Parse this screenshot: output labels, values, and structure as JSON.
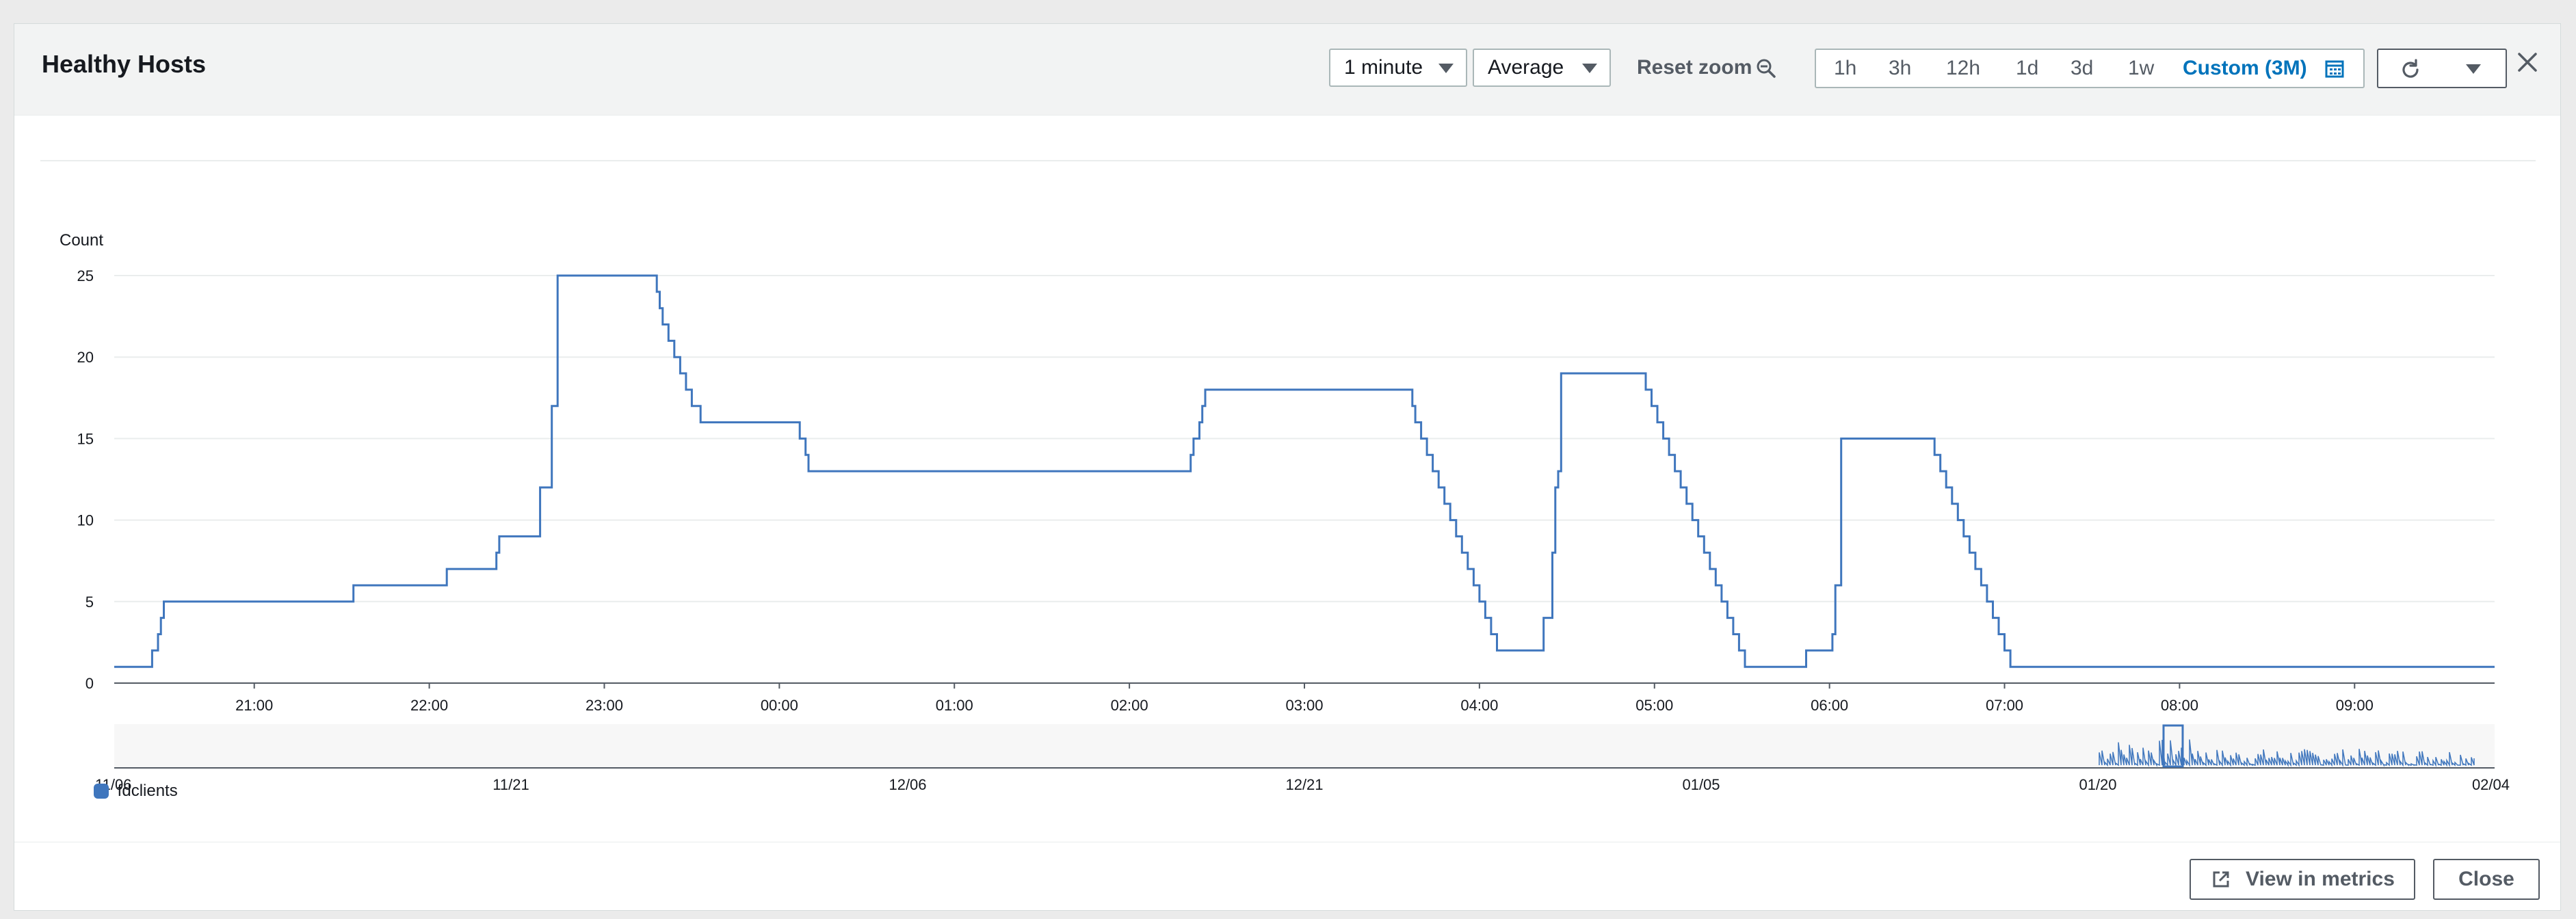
{
  "modal": {
    "title": "Healthy Hosts"
  },
  "toolbar": {
    "period": "1 minute",
    "statistic": "Average",
    "reset_zoom": "Reset zoom",
    "ranges": [
      "1h",
      "3h",
      "12h",
      "1d",
      "3d",
      "1w"
    ],
    "custom_range": "Custom (3M)",
    "icons": {
      "zoom": "zoom-out-icon",
      "calendar": "calendar-icon",
      "refresh": "refresh-icon",
      "menu": "caret-down-icon",
      "close": "close-icon"
    }
  },
  "chart_data": {
    "type": "line",
    "title": "",
    "ylabel": "Count",
    "xlabel": "",
    "ylim": [
      0,
      25
    ],
    "yticks": [
      0,
      5,
      10,
      15,
      20,
      25
    ],
    "xticks": [
      "21:00",
      "22:00",
      "23:00",
      "00:00",
      "01:00",
      "02:00",
      "03:00",
      "04:00",
      "05:00",
      "06:00",
      "07:00",
      "08:00",
      "09:00"
    ],
    "grid": true,
    "color": "#3f76bd",
    "series": [
      {
        "name": "fdclients",
        "points": [
          [
            "20:12",
            1
          ],
          [
            "20:24",
            1
          ],
          [
            "20:25",
            2
          ],
          [
            "20:26",
            2
          ],
          [
            "20:27",
            3
          ],
          [
            "20:28",
            4
          ],
          [
            "20:29",
            5
          ],
          [
            "21:33",
            5
          ],
          [
            "21:34",
            6
          ],
          [
            "22:05",
            6
          ],
          [
            "22:06",
            7
          ],
          [
            "22:22",
            7
          ],
          [
            "22:23",
            8
          ],
          [
            "22:24",
            9
          ],
          [
            "22:37",
            9
          ],
          [
            "22:38",
            12
          ],
          [
            "22:41",
            12
          ],
          [
            "22:42",
            17
          ],
          [
            "22:43",
            17
          ],
          [
            "22:44",
            25
          ],
          [
            "23:17",
            25
          ],
          [
            "23:18",
            24
          ],
          [
            "23:19",
            23
          ],
          [
            "23:20",
            22
          ],
          [
            "23:22",
            21
          ],
          [
            "23:24",
            20
          ],
          [
            "23:26",
            19
          ],
          [
            "23:28",
            18
          ],
          [
            "23:30",
            17
          ],
          [
            "23:33",
            16
          ],
          [
            "00:06",
            16
          ],
          [
            "00:07",
            15
          ],
          [
            "00:09",
            14
          ],
          [
            "00:10",
            13
          ],
          [
            "02:20",
            13
          ],
          [
            "02:21",
            14
          ],
          [
            "02:22",
            15
          ],
          [
            "02:24",
            16
          ],
          [
            "02:25",
            17
          ],
          [
            "02:26",
            18
          ],
          [
            "03:36",
            18
          ],
          [
            "03:37",
            17
          ],
          [
            "03:38",
            16
          ],
          [
            "03:40",
            15
          ],
          [
            "03:42",
            14
          ],
          [
            "03:44",
            13
          ],
          [
            "03:46",
            12
          ],
          [
            "03:48",
            11
          ],
          [
            "03:50",
            10
          ],
          [
            "03:52",
            9
          ],
          [
            "03:54",
            8
          ],
          [
            "03:56",
            7
          ],
          [
            "03:58",
            6
          ],
          [
            "04:00",
            5
          ],
          [
            "04:02",
            4
          ],
          [
            "04:04",
            3
          ],
          [
            "04:06",
            2
          ],
          [
            "04:21",
            2
          ],
          [
            "04:22",
            4
          ],
          [
            "04:24",
            4
          ],
          [
            "04:25",
            8
          ],
          [
            "04:26",
            12
          ],
          [
            "04:27",
            13
          ],
          [
            "04:28",
            19
          ],
          [
            "04:56",
            19
          ],
          [
            "04:57",
            18
          ],
          [
            "04:59",
            17
          ],
          [
            "05:01",
            16
          ],
          [
            "05:03",
            15
          ],
          [
            "05:05",
            14
          ],
          [
            "05:07",
            13
          ],
          [
            "05:09",
            12
          ],
          [
            "05:11",
            11
          ],
          [
            "05:13",
            10
          ],
          [
            "05:15",
            9
          ],
          [
            "05:17",
            8
          ],
          [
            "05:19",
            7
          ],
          [
            "05:21",
            6
          ],
          [
            "05:23",
            5
          ],
          [
            "05:25",
            4
          ],
          [
            "05:27",
            3
          ],
          [
            "05:29",
            2
          ],
          [
            "05:31",
            1
          ],
          [
            "05:51",
            1
          ],
          [
            "05:52",
            2
          ],
          [
            "06:00",
            2
          ],
          [
            "06:01",
            3
          ],
          [
            "06:02",
            6
          ],
          [
            "06:03",
            6
          ],
          [
            "06:04",
            15
          ],
          [
            "06:35",
            15
          ],
          [
            "06:36",
            14
          ],
          [
            "06:38",
            13
          ],
          [
            "06:40",
            12
          ],
          [
            "06:42",
            11
          ],
          [
            "06:44",
            10
          ],
          [
            "06:46",
            9
          ],
          [
            "06:48",
            8
          ],
          [
            "06:50",
            7
          ],
          [
            "06:52",
            6
          ],
          [
            "06:54",
            5
          ],
          [
            "06:56",
            4
          ],
          [
            "06:58",
            3
          ],
          [
            "07:00",
            2
          ],
          [
            "07:02",
            1
          ],
          [
            "09:48",
            1
          ]
        ]
      }
    ],
    "overview": {
      "xticks": [
        "11/06",
        "11/21",
        "12/06",
        "12/21",
        "01/05",
        "01/20",
        "02/04"
      ]
    }
  },
  "legend": {
    "series": "fdclients"
  },
  "footer": {
    "view_in_metrics": "View in metrics",
    "close": "Close",
    "external_icon": "external-link-icon"
  }
}
